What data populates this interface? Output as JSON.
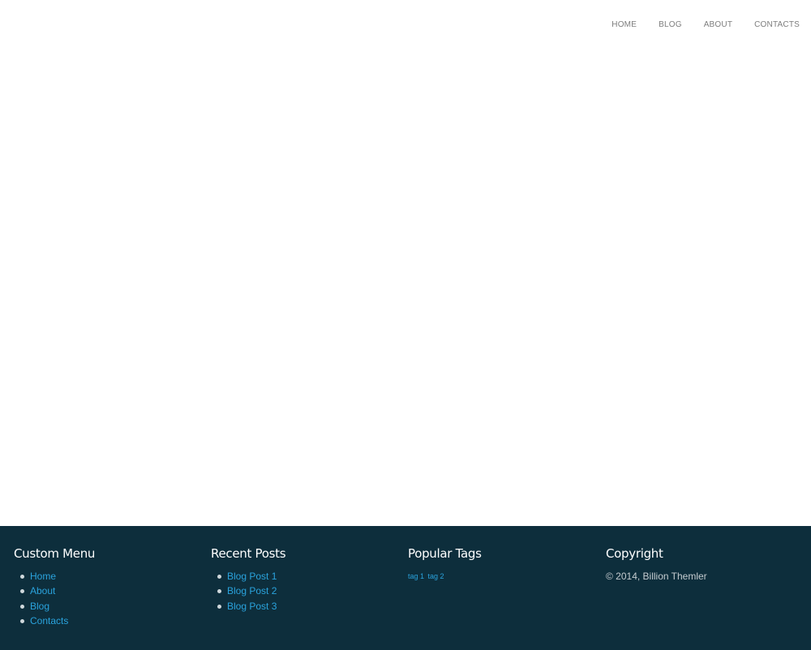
{
  "nav": {
    "items": [
      {
        "label": "HOME"
      },
      {
        "label": "BLOG"
      },
      {
        "label": "ABOUT"
      },
      {
        "label": "CONTACTS"
      }
    ]
  },
  "footer": {
    "custom_menu": {
      "title": "Custom Menu",
      "items": [
        {
          "label": "Home"
        },
        {
          "label": "About"
        },
        {
          "label": "Blog"
        },
        {
          "label": "Contacts"
        }
      ]
    },
    "recent_posts": {
      "title": "Recent Posts",
      "items": [
        {
          "label": "Blog Post 1"
        },
        {
          "label": "Blog Post 2"
        },
        {
          "label": "Blog Post 3"
        }
      ]
    },
    "popular_tags": {
      "title": "Popular Tags",
      "tags": [
        {
          "label": "tag 1"
        },
        {
          "label": "tag 2"
        }
      ]
    },
    "copyright": {
      "title": "Copyright",
      "text": "© 2014, Billion Themler"
    }
  },
  "colors": {
    "footer_bg": "#0d2e3c",
    "link": "#2aa3dd",
    "nav_text": "#7d7d7d"
  }
}
